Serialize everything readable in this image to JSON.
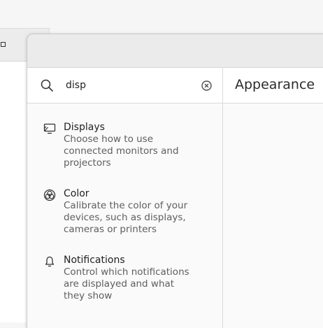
{
  "search": {
    "value": "disp",
    "search_icon": "search-icon",
    "clear_icon": "clear-icon"
  },
  "panel": {
    "title": "Appearance"
  },
  "results": [
    {
      "icon": "display-icon",
      "title": "Displays",
      "description": "Choose how to use connected monitors and projectors"
    },
    {
      "icon": "color-icon",
      "title": "Color",
      "description": "Calibrate the color of your devices, such as displays, cameras or printers"
    },
    {
      "icon": "bell-icon",
      "title": "Notifications",
      "description": "Control which notifications are displayed and what they show"
    }
  ],
  "colors": {
    "titlebar": "#ebebeb",
    "text": "#222222",
    "secondary_text": "#5e5e5e"
  }
}
